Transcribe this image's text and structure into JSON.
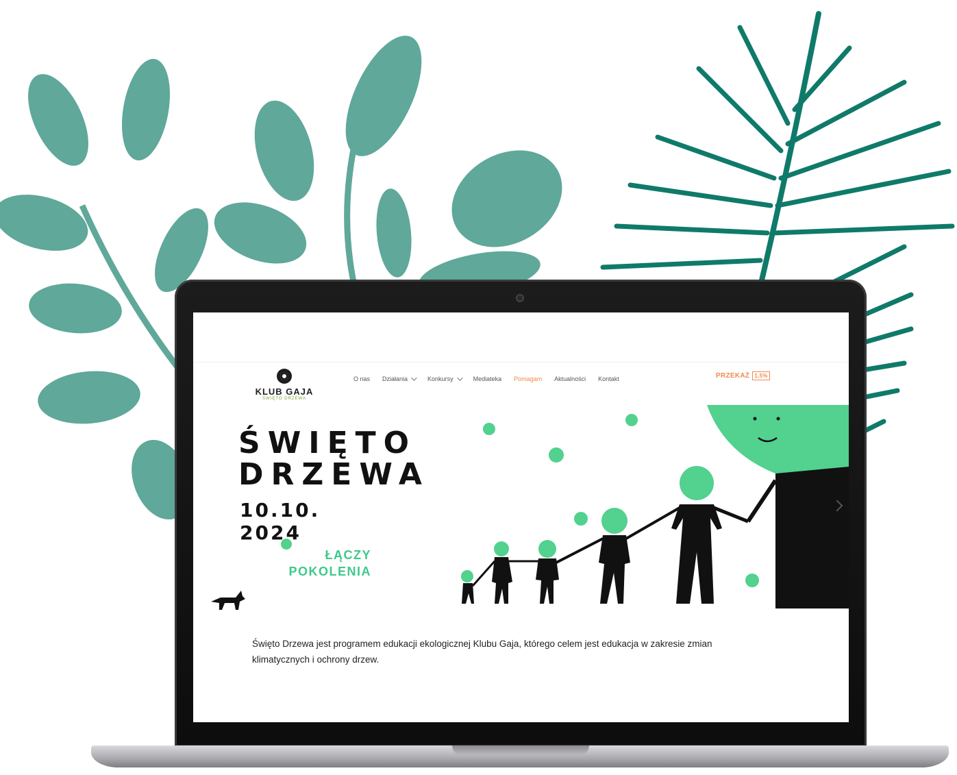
{
  "header": {
    "logo_title": "KLUB GAJA",
    "logo_subtitle": "ŚWIĘTO DRZEWA",
    "nav": [
      {
        "label": "O nas",
        "has_dropdown": false,
        "active": false
      },
      {
        "label": "Działania",
        "has_dropdown": true,
        "active": false
      },
      {
        "label": "Konkursy",
        "has_dropdown": true,
        "active": false
      },
      {
        "label": "Mediateka",
        "has_dropdown": false,
        "active": false
      },
      {
        "label": "Pomagam",
        "has_dropdown": false,
        "active": true
      },
      {
        "label": "Aktualności",
        "has_dropdown": false,
        "active": false
      },
      {
        "label": "Kontakt",
        "has_dropdown": false,
        "active": false
      }
    ],
    "przekaz_label": "PRZEKAŻ",
    "przekaz_badge": "1,5%"
  },
  "hero": {
    "title_line1": "ŚWIĘTO",
    "title_line2": "DRZEWA",
    "date": "10.10. 2024",
    "tagline_line1": "ŁĄCZY",
    "tagline_line2": "POKOLENIA"
  },
  "description": "Święto Drzewa jest programem edukacji ekologicznej Klubu Gaja, którego celem jest edukacja w zakresie zmian klimatycznych i ochrony drzew.",
  "colors": {
    "accent_green": "#3ec98a",
    "accent_orange": "#f08a4b",
    "leaf_green": "#5fa89a",
    "palm_green": "#0f7a6a"
  }
}
